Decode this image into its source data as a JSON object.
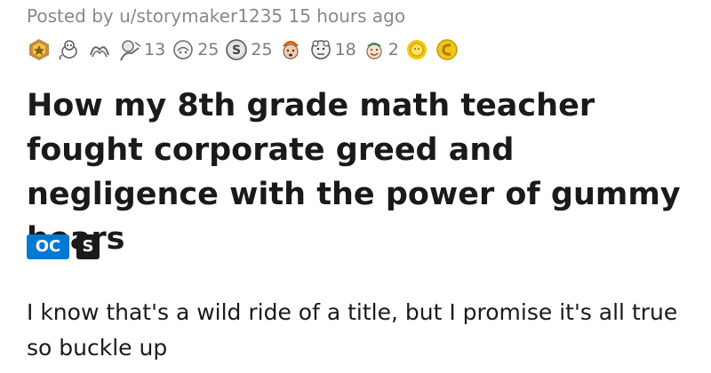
{
  "post": {
    "posted_by_prefix": "Posted by",
    "username": "u/storymaker1235",
    "time_ago": "15 hours ago",
    "awards": [
      {
        "icon": "hero-badge-icon",
        "count": ""
      },
      {
        "icon": "wholesome-seal-icon",
        "count": ""
      },
      {
        "icon": "wearing-is-caring-icon",
        "count": ""
      },
      {
        "icon": "take-my-energy-icon",
        "count": "13"
      },
      {
        "icon": "helpful-icon",
        "count": "25"
      },
      {
        "icon": "silver-coin-icon",
        "count": "25"
      },
      {
        "icon": "mind-blown-icon",
        "count": ""
      },
      {
        "icon": "hugz-icon",
        "count": "18"
      },
      {
        "icon": "wholesome-icon",
        "count": "2"
      },
      {
        "icon": "gold-sun-icon",
        "count": ""
      },
      {
        "icon": "gold-coin-icon",
        "count": ""
      }
    ],
    "title": "How my 8th grade math teacher fought corporate greed and negligence with the power of gummy bears",
    "flairs": {
      "oc": "OC",
      "spoiler": "S"
    },
    "body": "I know that's a wild ride of a title, but I promise it's all true so buckle up",
    "colors": {
      "oc_flair": "#0079d3",
      "spoiler_flair": "#1a1a1b",
      "meta_text": "#878a8c"
    }
  }
}
